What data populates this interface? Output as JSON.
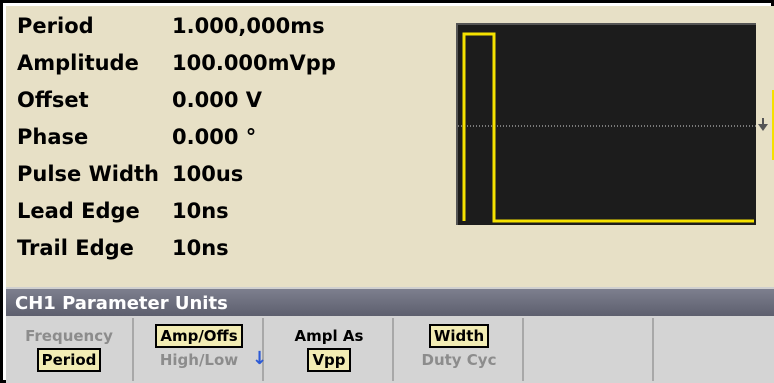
{
  "params": [
    {
      "label": "Period",
      "value": "1.000,000ms"
    },
    {
      "label": "Amplitude",
      "value": "100.000mVpp"
    },
    {
      "label": "Offset",
      "value": "0.000 V"
    },
    {
      "label": "Phase",
      "value": "0.000 °"
    },
    {
      "label": "Pulse Width",
      "value": "100us"
    },
    {
      "label": "Lead Edge",
      "value": "10ns"
    },
    {
      "label": "Trail Edge",
      "value": "10ns"
    }
  ],
  "title_bar": "CH1 Parameter Units",
  "softkeys": [
    {
      "line1": "Frequency",
      "line2": "Period"
    },
    {
      "line1": "Amp/Offs",
      "line2": "High/Low"
    },
    {
      "line1": "Ampl As",
      "line2": "Vpp"
    },
    {
      "line1": "Width",
      "line2": "Duty Cyc"
    },
    {
      "line1": "",
      "line2": ""
    },
    {
      "line1": "",
      "line2": ""
    }
  ],
  "colors": {
    "param_bg": "#e7e0c6",
    "scope_bg": "#1c1c1c",
    "trace": "#f5e100",
    "title_bar": "#6a6c7b",
    "softkey_bg": "#d4d4d4",
    "selected_bg": "#f2ecb4",
    "arrow": "#2c5ad6"
  },
  "icons": {
    "scroll_arrow": "down-arrow-icon",
    "offset_marker": "triangle-down-icon"
  }
}
